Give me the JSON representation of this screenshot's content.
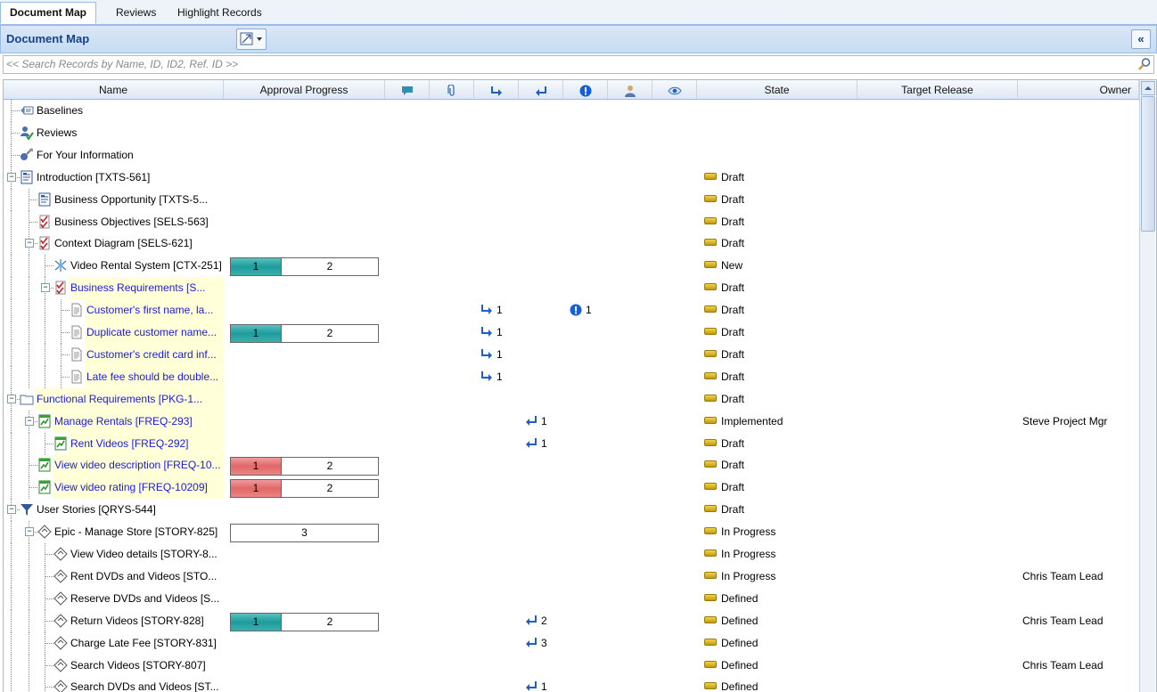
{
  "tabs": [
    {
      "label": "Document Map",
      "active": true
    },
    {
      "label": "Reviews",
      "active": false
    },
    {
      "label": "Highlight Records",
      "active": false
    }
  ],
  "panel": {
    "title": "Document Map",
    "collapse_label": "«"
  },
  "search": {
    "placeholder": "<< Search Records by Name, ID, ID2, Ref. ID >>"
  },
  "columns": {
    "name": "Name",
    "approval": "Approval Progress",
    "state": "State",
    "target_release": "Target Release",
    "owner": "Owner",
    "icons": [
      "comment-icon",
      "attachment-icon",
      "downstream-link-icon",
      "upstream-link-icon",
      "suspect-icon",
      "user-icon",
      "watch-icon"
    ]
  },
  "colors": {
    "accent": "#15428b",
    "highlight": "#ffffd8",
    "progress_teal": "#1e9b9b",
    "progress_red": "#e06868",
    "link_text": "#1a1ae6"
  },
  "rows": [
    {
      "level": 0,
      "icon": "baseline-icon",
      "name": "Baselines"
    },
    {
      "level": 0,
      "icon": "review-icon",
      "name": "Reviews"
    },
    {
      "level": 0,
      "icon": "fyi-icon",
      "name": "For Your Information"
    },
    {
      "level": 0,
      "icon": "text-doc-icon",
      "name": "Introduction [TXTS-561]",
      "expand": true,
      "state": "Draft"
    },
    {
      "level": 1,
      "icon": "text-doc-icon",
      "name": "Business Opportunity [TXTS-5...",
      "state": "Draft"
    },
    {
      "level": 1,
      "icon": "spec-icon",
      "name": "Business Objectives [SELS-563]",
      "state": "Draft"
    },
    {
      "level": 1,
      "icon": "spec-icon",
      "name": "Context Diagram [SELS-621]",
      "expand": true,
      "state": "Draft"
    },
    {
      "level": 2,
      "icon": "diagram-icon",
      "name": "Video Rental System [CTX-251]",
      "progress": {
        "kind": "teal",
        "a": "1",
        "b": "2"
      },
      "state": "New"
    },
    {
      "level": 2,
      "icon": "spec-icon",
      "name": "Business Requirements [S...",
      "expand": true,
      "link": true,
      "hl": true,
      "state": "Draft"
    },
    {
      "level": 3,
      "icon": "requirement-icon",
      "name": "Customer's first name, la...",
      "link": true,
      "hl": true,
      "down": "1",
      "suspect": "1",
      "state": "Draft"
    },
    {
      "level": 3,
      "icon": "requirement-icon",
      "name": "Duplicate customer name...",
      "link": true,
      "hl": true,
      "progress": {
        "kind": "teal",
        "a": "1",
        "b": "2"
      },
      "down": "1",
      "state": "Draft"
    },
    {
      "level": 3,
      "icon": "requirement-icon",
      "name": "Customer's credit card inf...",
      "link": true,
      "hl": true,
      "down": "1",
      "state": "Draft"
    },
    {
      "level": 3,
      "icon": "requirement-icon",
      "name": "Late fee should be double...",
      "link": true,
      "hl": true,
      "down": "1",
      "state": "Draft"
    },
    {
      "level": 0,
      "icon": "folder-icon",
      "name": "Functional Requirements [PKG-1...",
      "expand": true,
      "link": true,
      "hl": true,
      "state": "Draft"
    },
    {
      "level": 1,
      "icon": "functional-req-icon",
      "name": "Manage Rentals [FREQ-293]",
      "expand": true,
      "link": true,
      "hl": true,
      "up": "1",
      "state": "Implemented",
      "owner": "Steve Project Mgr"
    },
    {
      "level": 2,
      "icon": "functional-req-icon",
      "name": "Rent Videos [FREQ-292]",
      "link": true,
      "hl": true,
      "up": "1",
      "state": "Draft"
    },
    {
      "level": 1,
      "icon": "functional-req-icon",
      "name": "View video description [FREQ-10...",
      "link": true,
      "hl": true,
      "progress": {
        "kind": "red",
        "a": "1",
        "b": "2"
      },
      "state": "Draft"
    },
    {
      "level": 1,
      "icon": "functional-req-icon",
      "name": "View video rating [FREQ-10209]",
      "link": true,
      "hl": true,
      "progress": {
        "kind": "red",
        "a": "1",
        "b": "2"
      },
      "state": "Draft"
    },
    {
      "level": 0,
      "icon": "filter-icon",
      "name": "User Stories [QRYS-544]",
      "expand": true,
      "state": "Draft"
    },
    {
      "level": 1,
      "icon": "story-icon",
      "name": "Epic - Manage Store [STORY-825]",
      "expand": true,
      "progress": {
        "kind": "full",
        "a": "3"
      },
      "state": "In Progress"
    },
    {
      "level": 2,
      "icon": "story-icon",
      "name": "View Video details [STORY-8...",
      "state": "In Progress"
    },
    {
      "level": 2,
      "icon": "story-icon",
      "name": "Rent DVDs and Videos [STO...",
      "state": "In Progress",
      "owner": "Chris Team Lead"
    },
    {
      "level": 2,
      "icon": "story-icon",
      "name": "Reserve DVDs and Videos [S...",
      "state": "Defined"
    },
    {
      "level": 2,
      "icon": "story-icon",
      "name": "Return Videos [STORY-828]",
      "progress": {
        "kind": "teal",
        "a": "1",
        "b": "2"
      },
      "up": "2",
      "state": "Defined",
      "owner": "Chris Team Lead"
    },
    {
      "level": 2,
      "icon": "story-icon",
      "name": "Charge Late Fee [STORY-831]",
      "up": "3",
      "state": "Defined"
    },
    {
      "level": 2,
      "icon": "story-icon",
      "name": "Search Videos [STORY-807]",
      "state": "Defined",
      "owner": "Chris Team Lead"
    },
    {
      "level": 2,
      "icon": "story-icon",
      "name": "Search DVDs and Videos [ST...",
      "up": "1",
      "state": "Defined"
    }
  ]
}
